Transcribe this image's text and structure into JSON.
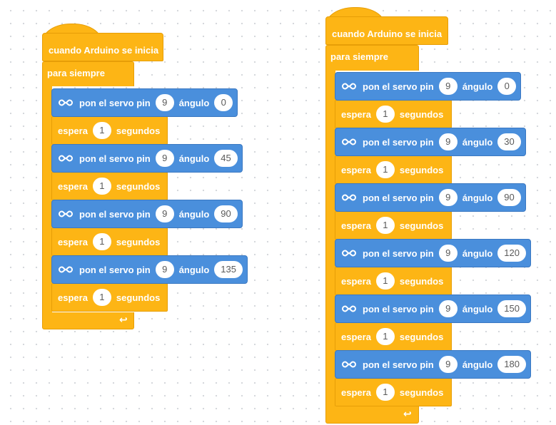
{
  "colors": {
    "control": "#fdb515",
    "servo": "#4a8fdc",
    "text": "#ffffff",
    "pill_text": "#5a5a5a"
  },
  "program_left": {
    "hat_label": "cuando Arduino se inicia",
    "loop_label": "para siempre",
    "loop_end_icon": "loop-arrow-icon",
    "steps": [
      {
        "servo_prefix": "pon el servo pin",
        "pin": "9",
        "angle_label": "ángulo",
        "angle": "0",
        "wait_label": "espera",
        "seconds": "1",
        "seconds_label": "segundos"
      },
      {
        "servo_prefix": "pon el servo pin",
        "pin": "9",
        "angle_label": "ángulo",
        "angle": "45",
        "wait_label": "espera",
        "seconds": "1",
        "seconds_label": "segundos"
      },
      {
        "servo_prefix": "pon el servo pin",
        "pin": "9",
        "angle_label": "ángulo",
        "angle": "90",
        "wait_label": "espera",
        "seconds": "1",
        "seconds_label": "segundos"
      },
      {
        "servo_prefix": "pon el servo pin",
        "pin": "9",
        "angle_label": "ángulo",
        "angle": "135",
        "wait_label": "espera",
        "seconds": "1",
        "seconds_label": "segundos"
      }
    ]
  },
  "program_right": {
    "hat_label": "cuando Arduino se inicia",
    "loop_label": "para siempre",
    "loop_end_icon": "loop-arrow-icon",
    "steps": [
      {
        "servo_prefix": "pon el servo pin",
        "pin": "9",
        "angle_label": "ángulo",
        "angle": "0",
        "wait_label": "espera",
        "seconds": "1",
        "seconds_label": "segundos"
      },
      {
        "servo_prefix": "pon el servo pin",
        "pin": "9",
        "angle_label": "ángulo",
        "angle": "30",
        "wait_label": "espera",
        "seconds": "1",
        "seconds_label": "segundos"
      },
      {
        "servo_prefix": "pon el servo pin",
        "pin": "9",
        "angle_label": "ángulo",
        "angle": "90",
        "wait_label": "espera",
        "seconds": "1",
        "seconds_label": "segundos"
      },
      {
        "servo_prefix": "pon el servo pin",
        "pin": "9",
        "angle_label": "ángulo",
        "angle": "120",
        "wait_label": "espera",
        "seconds": "1",
        "seconds_label": "segundos"
      },
      {
        "servo_prefix": "pon el servo pin",
        "pin": "9",
        "angle_label": "ángulo",
        "angle": "150",
        "wait_label": "espera",
        "seconds": "1",
        "seconds_label": "segundos"
      },
      {
        "servo_prefix": "pon el servo pin",
        "pin": "9",
        "angle_label": "ángulo",
        "angle": "180",
        "wait_label": "espera",
        "seconds": "1",
        "seconds_label": "segundos"
      }
    ]
  }
}
